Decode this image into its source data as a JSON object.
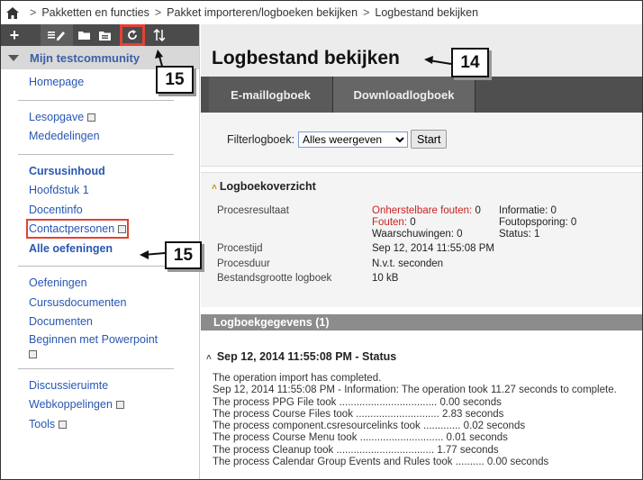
{
  "breadcrumb": {
    "items": [
      "Pakketten en functies",
      "Pakket importeren/logboeken bekijken",
      "Logbestand bekijken"
    ],
    "separator": ">"
  },
  "toolbar": {
    "add": "+",
    "icons": [
      "list-edit-icon",
      "folder-icon",
      "folder-open-icon",
      "refresh-icon",
      "sort-icon"
    ]
  },
  "sidebar": {
    "community": "Mijn testcommunity",
    "group1": [
      {
        "label": "Homepage"
      }
    ],
    "group2": [
      {
        "label": "Lesopgave"
      },
      {
        "label": "Mededelingen"
      }
    ],
    "group3": [
      {
        "label": "Cursusinhoud"
      },
      {
        "label": "Hoofdstuk 1"
      },
      {
        "label": "Docentinfo"
      },
      {
        "label": "Contactpersonen"
      },
      {
        "label": "Alle oefeningen"
      }
    ],
    "group4": [
      {
        "label": "Oefeningen"
      },
      {
        "label": "Cursusdocumenten"
      },
      {
        "label": "Documenten"
      },
      {
        "label": "Beginnen met Powerpoint"
      }
    ],
    "group5": [
      {
        "label": "Discussieruimte"
      },
      {
        "label": "Webkoppelingen"
      },
      {
        "label": "Tools"
      }
    ]
  },
  "main": {
    "title": "Logbestand bekijken",
    "tabs": [
      {
        "label": "E-maillogboek"
      },
      {
        "label": "Downloadlogboek"
      }
    ],
    "filter": {
      "label": "Filterlogboek:",
      "selected": "Alles weergeven",
      "button": "Start"
    }
  },
  "overview": {
    "heading": "Logboekoverzicht",
    "labels": {
      "result": "Procesresultaat",
      "time": "Procestijd",
      "duration": "Procesduur",
      "size": "Bestandsgrootte logboek"
    },
    "result": {
      "unrecoverable": "Onherstelbare fouten:",
      "unrecoverable_count": "0",
      "errors": "Fouten:",
      "errors_count": "0",
      "warnings": "Waarschuwingen: 0",
      "info": "Informatie: 0",
      "debug": "Foutopsporing: 0",
      "status": "Status: 1"
    },
    "time": "Sep 12, 2014 11:55:08 PM",
    "duration": "N.v.t. seconden",
    "size": "10 kB"
  },
  "log": {
    "section": "Logboekgegevens (1)",
    "entry_title": "Sep 12, 2014 11:55:08 PM - Status",
    "lines": [
      "The operation import has completed.",
      "Sep 12, 2014 11:55:08 PM - Information: The operation took 11.27 seconds to complete.",
      "The process PPG File took .................................. 0.00 seconds",
      "The process Course Files took ............................. 2.83 seconds",
      "The process component.csresourcelinks took ............. 0.02 seconds",
      "The process Course Menu took ............................. 0.01 seconds",
      "The process Cleanup took .................................. 1.77 seconds",
      "The process Calendar Group Events and Rules took .......... 0.00 seconds"
    ]
  },
  "callouts": {
    "c14": "14",
    "c15a": "15",
    "c15b": "15"
  },
  "colors": {
    "highlight": "#e34234",
    "link": "#2856b3",
    "error": "#cc2222"
  }
}
